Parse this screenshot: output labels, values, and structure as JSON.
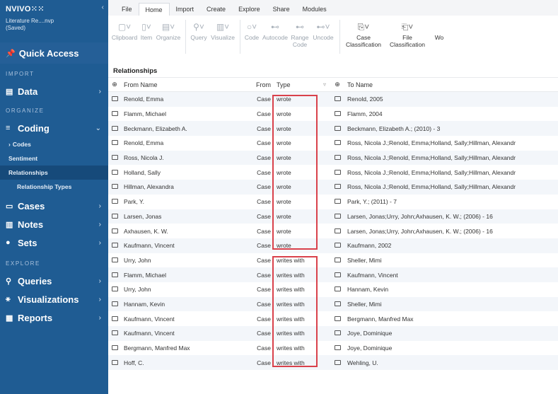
{
  "app": {
    "logo": "NVIVO⁙⁙",
    "collapse_icon": "‹",
    "project_name": "Literature Re....nvp",
    "project_status": "(Saved)"
  },
  "sidebar": {
    "quick_access": "Quick Access",
    "sections": {
      "import": "IMPORT",
      "organize": "ORGANIZE",
      "explore": "EXPLORE"
    },
    "data": "Data",
    "coding": "Coding",
    "codes": "Codes",
    "sentiment": "Sentiment",
    "relationships": "Relationships",
    "relationship_types": "Relationship Types",
    "cases": "Cases",
    "notes": "Notes",
    "sets": "Sets",
    "queries": "Queries",
    "visualizations": "Visualizations",
    "reports": "Reports",
    "chevron_right": "›",
    "chevron_down": "⌄"
  },
  "ribbon": {
    "tabs": [
      "File",
      "Home",
      "Import",
      "Create",
      "Explore",
      "Share",
      "Modules"
    ],
    "tools": {
      "clipboard": "Clipboard",
      "item": "Item",
      "organize": "Organize",
      "query": "Query",
      "visualize": "Visualize",
      "code": "Code",
      "autocode": "Autocode",
      "range_code": "Range Code",
      "uncode": "Uncode",
      "case_classification": "Case Classification",
      "file_classification": "File Classification",
      "wo": "Wo"
    }
  },
  "table": {
    "title": "Relationships",
    "headers": {
      "from_name": "From Name",
      "from": "From",
      "type": "Type",
      "to_name": "To Name"
    },
    "rows": [
      {
        "from_name": "Renold, Emma",
        "from": "Case",
        "type": "wrote",
        "to_name": "Renold, 2005"
      },
      {
        "from_name": "Flamm, Michael",
        "from": "Case",
        "type": "wrote",
        "to_name": "Flamm, 2004"
      },
      {
        "from_name": "Beckmann, Elizabeth A.",
        "from": "Case",
        "type": "wrote",
        "to_name": "Beckmann, Elizabeth A.; (2010) - 3"
      },
      {
        "from_name": "Renold, Emma",
        "from": "Case",
        "type": "wrote",
        "to_name": "Ross, Nicola J.;Renold, Emma;Holland, Sally;Hillman, Alexandr"
      },
      {
        "from_name": "Ross, Nicola J.",
        "from": "Case",
        "type": "wrote",
        "to_name": "Ross, Nicola J.;Renold, Emma;Holland, Sally;Hillman, Alexandr"
      },
      {
        "from_name": "Holland, Sally",
        "from": "Case",
        "type": "wrote",
        "to_name": "Ross, Nicola J.;Renold, Emma;Holland, Sally;Hillman, Alexandr"
      },
      {
        "from_name": "Hillman, Alexandra",
        "from": "Case",
        "type": "wrote",
        "to_name": "Ross, Nicola J.;Renold, Emma;Holland, Sally;Hillman, Alexandr"
      },
      {
        "from_name": "Park, Y.",
        "from": "Case",
        "type": "wrote",
        "to_name": "Park, Y.; (2011) - 7"
      },
      {
        "from_name": "Larsen, Jonas",
        "from": "Case",
        "type": "wrote",
        "to_name": "Larsen, Jonas;Urry, John;Axhausen, K. W.; (2006) - 16"
      },
      {
        "from_name": "Axhausen, K. W.",
        "from": "Case",
        "type": "wrote",
        "to_name": "Larsen, Jonas;Urry, John;Axhausen, K. W.; (2006) - 16"
      },
      {
        "from_name": "Kaufmann, Vincent",
        "from": "Case",
        "type": "wrote",
        "to_name": "Kaufmann, 2002"
      },
      {
        "from_name": "Urry, John",
        "from": "Case",
        "type": "writes with",
        "to_name": "Sheller, Mimi"
      },
      {
        "from_name": "Flamm, Michael",
        "from": "Case",
        "type": "writes with",
        "to_name": "Kaufmann, Vincent"
      },
      {
        "from_name": "Urry, John",
        "from": "Case",
        "type": "writes with",
        "to_name": "Hannam, Kevin"
      },
      {
        "from_name": "Hannam, Kevin",
        "from": "Case",
        "type": "writes with",
        "to_name": "Sheller, Mimi"
      },
      {
        "from_name": "Kaufmann, Vincent",
        "from": "Case",
        "type": "writes with",
        "to_name": "Bergmann, Manfred Max"
      },
      {
        "from_name": "Kaufmann, Vincent",
        "from": "Case",
        "type": "writes with",
        "to_name": "Joye, Dominique"
      },
      {
        "from_name": "Bergmann, Manfred Max",
        "from": "Case",
        "type": "writes with",
        "to_name": "Joye, Dominique"
      },
      {
        "from_name": "Hoff, C.",
        "from": "Case",
        "type": "writes with",
        "to_name": "Wehling, U."
      }
    ]
  },
  "colors": {
    "sidebar": "#1f5c93",
    "highlight": "#d9414b",
    "stripe": "#f3f6fa"
  }
}
